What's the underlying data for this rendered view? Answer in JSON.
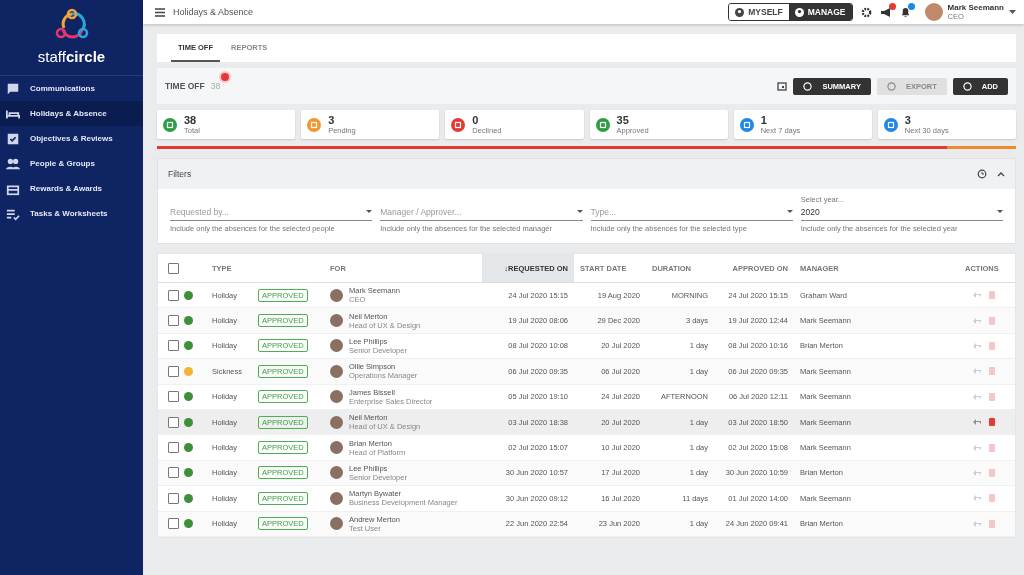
{
  "sidebar": {
    "logo": "staff**circle**",
    "items": [
      {
        "label": "Communications",
        "selected": false
      },
      {
        "label": "Holidays & Absence",
        "selected": true
      },
      {
        "label": "Objectives & Reviews",
        "selected": false
      },
      {
        "label": "People & Groups",
        "selected": false
      },
      {
        "label": "Rewards & Awards",
        "selected": false
      },
      {
        "label": "Tasks & Worksheets",
        "selected": false
      }
    ]
  },
  "topbar": {
    "title": "Holidays & Absence",
    "modes": [
      {
        "label": "MYSELF",
        "selected": false
      },
      {
        "label": "MANAGE",
        "selected": true
      }
    ],
    "user": {
      "name": "Mark Seemann",
      "role": "CEO"
    }
  },
  "tabs": [
    {
      "label": "TIME OFF",
      "selected": true
    },
    {
      "label": "REPORTS",
      "selected": false
    }
  ],
  "section": {
    "title": "TIME OFF",
    "count": "38",
    "actions": [
      {
        "label": "SUMMARY",
        "disabled": false
      },
      {
        "label": "EXPORT",
        "disabled": true
      },
      {
        "label": "ADD",
        "disabled": false
      }
    ]
  },
  "stats": [
    {
      "value": "38",
      "label": "Total",
      "color": "#2e9e44"
    },
    {
      "value": "3",
      "label": "Pending",
      "color": "#f39530"
    },
    {
      "value": "0",
      "label": "Declined",
      "color": "#e53935"
    },
    {
      "value": "35",
      "label": "Approved",
      "color": "#2e9e44"
    },
    {
      "value": "1",
      "label": "Next 7 days",
      "color": "#1e88e5"
    },
    {
      "value": "3",
      "label": "Next 30 days",
      "color": "#1e88e5"
    }
  ],
  "progress": {
    "level": 0.92
  },
  "filters": {
    "title": "Filters",
    "fields": [
      {
        "placeholder": "Requested by...",
        "hint": "Include only the absences for the selected people"
      },
      {
        "placeholder": "Manager / Approver...",
        "hint": "Include only the absences for the selected manager"
      },
      {
        "placeholder": "Type...",
        "hint": "Include only the absences for the selected type"
      },
      {
        "label": "Select year...",
        "value": "2020",
        "hint": "Include only the absences for the selected year"
      }
    ]
  },
  "table": {
    "columns": [
      {
        "label": "TYPE",
        "sorted": false
      },
      {
        "label": "FOR",
        "sorted": false
      },
      {
        "label": "REQUESTED ON",
        "sorted": true
      },
      {
        "label": "START DATE",
        "sorted": false
      },
      {
        "label": "DURATION",
        "sorted": false
      },
      {
        "label": "APPROVED ON",
        "sorted": false
      },
      {
        "label": "MANAGER",
        "sorted": false
      },
      {
        "label": "ACTIONS",
        "sorted": false
      }
    ],
    "sort_arrow": "↓",
    "all_checked": false,
    "rows": [
      {
        "checked": false,
        "color": "#3f8f3a",
        "type": "Holiday",
        "status": "APPROVED",
        "name": "Mark Seemann",
        "role": "CEO",
        "requested": "24 Jul 2020 15:15",
        "start": "19 Aug 2020",
        "duration": "MORNING",
        "approved": "24 Jul 2020 15:15",
        "manager": "Graham Ward",
        "hovered": false
      },
      {
        "checked": false,
        "color": "#3f8f3a",
        "type": "Holiday",
        "status": "APPROVED",
        "name": "Neil Merton",
        "role": "Head of UX & Design",
        "requested": "19 Jul 2020 08:06",
        "start": "29 Dec 2020",
        "duration": "3 days",
        "approved": "19 Jul 2020 12:44",
        "manager": "Mark Seemann",
        "hovered": false
      },
      {
        "checked": false,
        "color": "#3f8f3a",
        "type": "Holiday",
        "status": "APPROVED",
        "name": "Lee Phillips",
        "role": "Senior Developer",
        "requested": "08 Jul 2020 10:08",
        "start": "20 Jul 2020",
        "duration": "1 day",
        "approved": "08 Jul 2020 10:16",
        "manager": "Brian Merton",
        "hovered": false
      },
      {
        "checked": false,
        "color": "#f2b233",
        "type": "Sickness",
        "status": "APPROVED",
        "name": "Ollie Simpson",
        "role": "Operations Manager",
        "requested": "06 Jul 2020 09:35",
        "start": "06 Jul 2020",
        "duration": "1 day",
        "approved": "06 Jul 2020 09:35",
        "manager": "Mark Seemann",
        "hovered": false
      },
      {
        "checked": false,
        "color": "#3f8f3a",
        "type": "Holiday",
        "status": "APPROVED",
        "name": "James Bissell",
        "role": "Enterprise Sales Director",
        "requested": "05 Jul 2020 19:10",
        "start": "24 Jul 2020",
        "duration": "AFTERNOON",
        "approved": "06 Jul 2020 12:11",
        "manager": "Mark Seemann",
        "hovered": false
      },
      {
        "checked": false,
        "color": "#3f8f3a",
        "type": "Holiday",
        "status": "APPROVED",
        "name": "Neil Merton",
        "role": "Head of UX & Design",
        "requested": "03 Jul 2020 18:38",
        "start": "20 Jul 2020",
        "duration": "1 day",
        "approved": "03 Jul 2020 18:50",
        "manager": "Mark Seemann",
        "hovered": true
      },
      {
        "checked": false,
        "color": "#3f8f3a",
        "type": "Holiday",
        "status": "APPROVED",
        "name": "Brian Merton",
        "role": "Head of Platform",
        "requested": "02 Jul 2020 15:07",
        "start": "10 Jul 2020",
        "duration": "1 day",
        "approved": "02 Jul 2020 15:08",
        "manager": "Mark Seemann",
        "hovered": false
      },
      {
        "checked": false,
        "color": "#3f8f3a",
        "type": "Holiday",
        "status": "APPROVED",
        "name": "Lee Phillips",
        "role": "Senior Developer",
        "requested": "30 Jun 2020 10:57",
        "start": "17 Jul 2020",
        "duration": "1 day",
        "approved": "30 Jun 2020 10:59",
        "manager": "Brian Merton",
        "hovered": false
      },
      {
        "checked": false,
        "color": "#3f8f3a",
        "type": "Holiday",
        "status": "APPROVED",
        "name": "Martyn Bywater",
        "role": "Business Development Manager",
        "requested": "30 Jun 2020 09:12",
        "start": "16 Jul 2020",
        "duration": "11 days",
        "approved": "01 Jul 2020 14:00",
        "manager": "Mark Seemann",
        "hovered": false
      },
      {
        "checked": false,
        "color": "#3f8f3a",
        "type": "Holiday",
        "status": "APPROVED",
        "name": "Andrew Merton",
        "role": "Test User",
        "requested": "22 Jun 2020 22:54",
        "start": "23 Jun 2020",
        "duration": "1 day",
        "approved": "24 Jun 2020 09:41",
        "manager": "Brian Merton",
        "hovered": false
      }
    ]
  }
}
